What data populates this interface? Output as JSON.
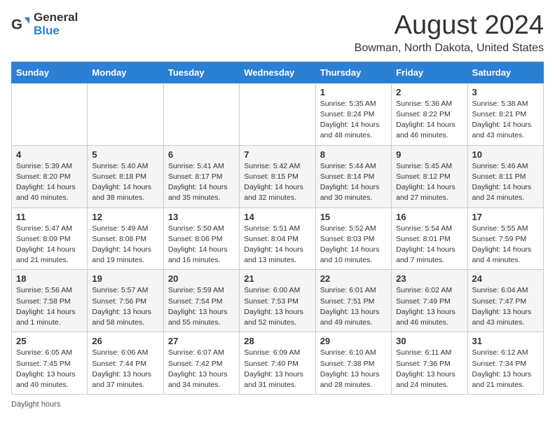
{
  "logo": {
    "general": "General",
    "blue": "Blue"
  },
  "title": "August 2024",
  "location": "Bowman, North Dakota, United States",
  "days_of_week": [
    "Sunday",
    "Monday",
    "Tuesday",
    "Wednesday",
    "Thursday",
    "Friday",
    "Saturday"
  ],
  "footer": "Daylight hours",
  "weeks": [
    [
      {
        "day": "",
        "info": ""
      },
      {
        "day": "",
        "info": ""
      },
      {
        "day": "",
        "info": ""
      },
      {
        "day": "",
        "info": ""
      },
      {
        "day": "1",
        "info": "Sunrise: 5:35 AM\nSunset: 8:24 PM\nDaylight: 14 hours\nand 48 minutes."
      },
      {
        "day": "2",
        "info": "Sunrise: 5:36 AM\nSunset: 8:22 PM\nDaylight: 14 hours\nand 46 minutes."
      },
      {
        "day": "3",
        "info": "Sunrise: 5:38 AM\nSunset: 8:21 PM\nDaylight: 14 hours\nand 43 minutes."
      }
    ],
    [
      {
        "day": "4",
        "info": "Sunrise: 5:39 AM\nSunset: 8:20 PM\nDaylight: 14 hours\nand 40 minutes."
      },
      {
        "day": "5",
        "info": "Sunrise: 5:40 AM\nSunset: 8:18 PM\nDaylight: 14 hours\nand 38 minutes."
      },
      {
        "day": "6",
        "info": "Sunrise: 5:41 AM\nSunset: 8:17 PM\nDaylight: 14 hours\nand 35 minutes."
      },
      {
        "day": "7",
        "info": "Sunrise: 5:42 AM\nSunset: 8:15 PM\nDaylight: 14 hours\nand 32 minutes."
      },
      {
        "day": "8",
        "info": "Sunrise: 5:44 AM\nSunset: 8:14 PM\nDaylight: 14 hours\nand 30 minutes."
      },
      {
        "day": "9",
        "info": "Sunrise: 5:45 AM\nSunset: 8:12 PM\nDaylight: 14 hours\nand 27 minutes."
      },
      {
        "day": "10",
        "info": "Sunrise: 5:46 AM\nSunset: 8:11 PM\nDaylight: 14 hours\nand 24 minutes."
      }
    ],
    [
      {
        "day": "11",
        "info": "Sunrise: 5:47 AM\nSunset: 8:09 PM\nDaylight: 14 hours\nand 21 minutes."
      },
      {
        "day": "12",
        "info": "Sunrise: 5:49 AM\nSunset: 8:08 PM\nDaylight: 14 hours\nand 19 minutes."
      },
      {
        "day": "13",
        "info": "Sunrise: 5:50 AM\nSunset: 8:06 PM\nDaylight: 14 hours\nand 16 minutes."
      },
      {
        "day": "14",
        "info": "Sunrise: 5:51 AM\nSunset: 8:04 PM\nDaylight: 14 hours\nand 13 minutes."
      },
      {
        "day": "15",
        "info": "Sunrise: 5:52 AM\nSunset: 8:03 PM\nDaylight: 14 hours\nand 10 minutes."
      },
      {
        "day": "16",
        "info": "Sunrise: 5:54 AM\nSunset: 8:01 PM\nDaylight: 14 hours\nand 7 minutes."
      },
      {
        "day": "17",
        "info": "Sunrise: 5:55 AM\nSunset: 7:59 PM\nDaylight: 14 hours\nand 4 minutes."
      }
    ],
    [
      {
        "day": "18",
        "info": "Sunrise: 5:56 AM\nSunset: 7:58 PM\nDaylight: 14 hours\nand 1 minute."
      },
      {
        "day": "19",
        "info": "Sunrise: 5:57 AM\nSunset: 7:56 PM\nDaylight: 13 hours\nand 58 minutes."
      },
      {
        "day": "20",
        "info": "Sunrise: 5:59 AM\nSunset: 7:54 PM\nDaylight: 13 hours\nand 55 minutes."
      },
      {
        "day": "21",
        "info": "Sunrise: 6:00 AM\nSunset: 7:53 PM\nDaylight: 13 hours\nand 52 minutes."
      },
      {
        "day": "22",
        "info": "Sunrise: 6:01 AM\nSunset: 7:51 PM\nDaylight: 13 hours\nand 49 minutes."
      },
      {
        "day": "23",
        "info": "Sunrise: 6:02 AM\nSunset: 7:49 PM\nDaylight: 13 hours\nand 46 minutes."
      },
      {
        "day": "24",
        "info": "Sunrise: 6:04 AM\nSunset: 7:47 PM\nDaylight: 13 hours\nand 43 minutes."
      }
    ],
    [
      {
        "day": "25",
        "info": "Sunrise: 6:05 AM\nSunset: 7:45 PM\nDaylight: 13 hours\nand 40 minutes."
      },
      {
        "day": "26",
        "info": "Sunrise: 6:06 AM\nSunset: 7:44 PM\nDaylight: 13 hours\nand 37 minutes."
      },
      {
        "day": "27",
        "info": "Sunrise: 6:07 AM\nSunset: 7:42 PM\nDaylight: 13 hours\nand 34 minutes."
      },
      {
        "day": "28",
        "info": "Sunrise: 6:09 AM\nSunset: 7:40 PM\nDaylight: 13 hours\nand 31 minutes."
      },
      {
        "day": "29",
        "info": "Sunrise: 6:10 AM\nSunset: 7:38 PM\nDaylight: 13 hours\nand 28 minutes."
      },
      {
        "day": "30",
        "info": "Sunrise: 6:11 AM\nSunset: 7:36 PM\nDaylight: 13 hours\nand 24 minutes."
      },
      {
        "day": "31",
        "info": "Sunrise: 6:12 AM\nSunset: 7:34 PM\nDaylight: 13 hours\nand 21 minutes."
      }
    ]
  ]
}
